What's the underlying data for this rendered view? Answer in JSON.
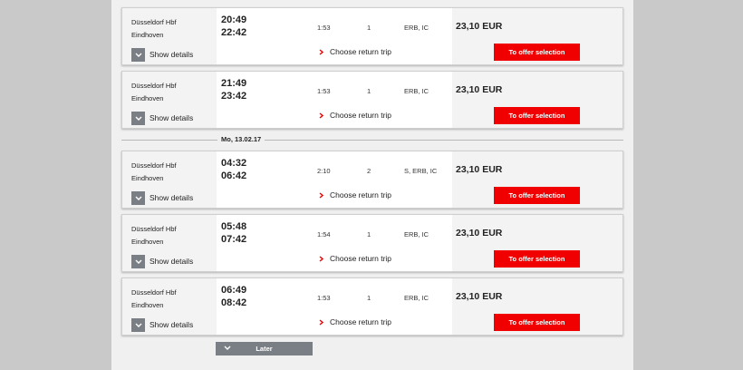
{
  "date_separator": "Mo, 13.02.17",
  "later_label": "Later",
  "colors": {
    "accent_red": "#f00000",
    "button_gray": "#7a7f85"
  },
  "connections": [
    {
      "from": "Düsseldorf Hbf",
      "to": "Eindhoven",
      "dep": "20:49",
      "arr": "22:42",
      "duration": "1:53",
      "changes": "1",
      "products": "ERB, IC",
      "price": "23,10 EUR",
      "details_label": "Show details",
      "return_label": "Choose return trip",
      "offer_label": "To offer selection"
    },
    {
      "from": "Düsseldorf Hbf",
      "to": "Eindhoven",
      "dep": "21:49",
      "arr": "23:42",
      "duration": "1:53",
      "changes": "1",
      "products": "ERB, IC",
      "price": "23,10 EUR",
      "details_label": "Show details",
      "return_label": "Choose return trip",
      "offer_label": "To offer selection"
    },
    {
      "from": "Düsseldorf Hbf",
      "to": "Eindhoven",
      "dep": "04:32",
      "arr": "06:42",
      "duration": "2:10",
      "changes": "2",
      "products": "S, ERB, IC",
      "price": "23,10 EUR",
      "details_label": "Show details",
      "return_label": "Choose return trip",
      "offer_label": "To offer selection"
    },
    {
      "from": "Düsseldorf Hbf",
      "to": "Eindhoven",
      "dep": "05:48",
      "arr": "07:42",
      "duration": "1:54",
      "changes": "1",
      "products": "ERB, IC",
      "price": "23,10 EUR",
      "details_label": "Show details",
      "return_label": "Choose return trip",
      "offer_label": "To offer selection"
    },
    {
      "from": "Düsseldorf Hbf",
      "to": "Eindhoven",
      "dep": "06:49",
      "arr": "08:42",
      "duration": "1:53",
      "changes": "1",
      "products": "ERB, IC",
      "price": "23,10 EUR",
      "details_label": "Show details",
      "return_label": "Choose return trip",
      "offer_label": "To offer selection"
    }
  ]
}
